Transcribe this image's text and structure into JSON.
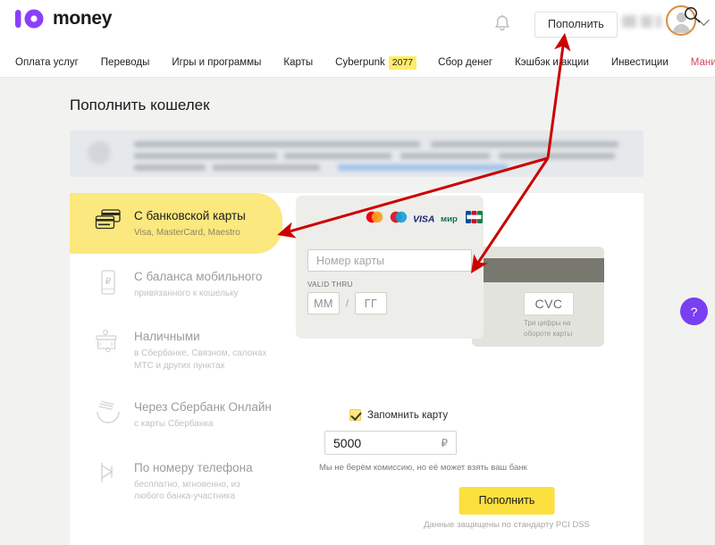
{
  "header": {
    "logo_word": "money",
    "logo_icon": "yoomoney-logo-icon",
    "bell_icon": "bell-icon",
    "topup_button": "Пополнить",
    "chevron_icon": "chevron-down-icon",
    "avatar_icon": "avatar",
    "search_icon": "search-icon"
  },
  "nav": {
    "items": [
      {
        "label": "Оплата услуг",
        "badge": "",
        "accent": false
      },
      {
        "label": "Переводы",
        "badge": "",
        "accent": false
      },
      {
        "label": "Игры и программы",
        "badge": "",
        "accent": false
      },
      {
        "label": "Карты",
        "badge": "",
        "accent": false
      },
      {
        "label": "Cyberpunk",
        "badge": "2077",
        "accent": false
      },
      {
        "label": "Сбор денег",
        "badge": "",
        "accent": false
      },
      {
        "label": "Кэшбэк и акции",
        "badge": "",
        "accent": false
      },
      {
        "label": "Инвестиции",
        "badge": "",
        "accent": false
      },
      {
        "label": "Манилэндия",
        "badge": "",
        "accent": true
      }
    ]
  },
  "page": {
    "title": "Пополнить кошелек"
  },
  "methods": [
    {
      "title": "С банковской карты",
      "subtitle": "Visa, MasterCard, Maestro",
      "icon": "credit-cards-icon",
      "selected": true
    },
    {
      "title": "С баланса мобильного",
      "subtitle": "привязанного к кошельку",
      "icon": "mobile-phone-icon",
      "selected": false
    },
    {
      "title": "Наличными",
      "subtitle": "в Сбербанке, Связном, салонах МТС и других пунктах",
      "icon": "cash-terminal-icon",
      "selected": false
    },
    {
      "title": "Через Сбербанк Онлайн",
      "subtitle": "с карты Сбербанка",
      "icon": "sberbank-icon",
      "selected": false
    },
    {
      "title": "По номеру телефона",
      "subtitle": "бесплатно, мгновенно, из любого банка-участника",
      "icon": "sbp-icon",
      "selected": false
    }
  ],
  "form": {
    "brands": [
      "mastercard-logo-icon",
      "maestro-logo-icon",
      "visa-logo-icon",
      "mir-logo-icon",
      "jcb-logo-icon"
    ],
    "card_number_placeholder": "Номер карты",
    "card_number_value": "",
    "valid_thru_label": "VALID THRU",
    "month_placeholder": "ММ",
    "year_placeholder": "ГГ",
    "separator": "/",
    "cvc_label": "CVC",
    "cvc_hint": "Три цифры на обороте карты",
    "remember_label": "Запомнить карту",
    "remember_checked": true,
    "amount_value": "5000",
    "currency_symbol": "₽",
    "fee_note": "Мы не берём комиссию, но её может взять ваш банк",
    "submit_label": "Пополнить",
    "pci_note": "Данные защищены по стандарту PCI DSS"
  },
  "help": {
    "label": "?",
    "icon": "question-mark-icon"
  },
  "annotations": {
    "color": "#cc0000",
    "arrows": [
      {
        "name": "arrow-to-topup-button",
        "target": "topup-button"
      },
      {
        "name": "arrow-to-card-method",
        "target": "bank-card-method"
      },
      {
        "name": "arrow-to-visa-logo",
        "target": "visa-logo"
      }
    ]
  },
  "colors": {
    "brand_purple": "#8b3ffd",
    "accent_yellow": "#fbe040",
    "selected_yellow": "#fbe87f",
    "nav_accent_red": "#d4485a",
    "annotation_red": "#cc0000",
    "page_bg": "#f2f2f0"
  }
}
